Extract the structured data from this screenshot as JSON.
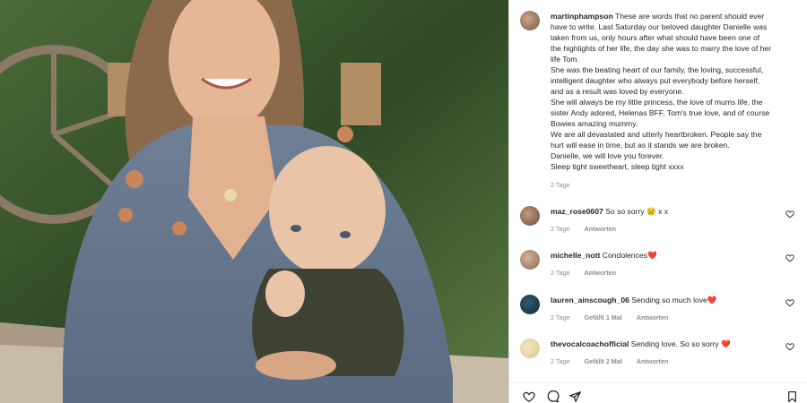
{
  "post": {
    "username": "martinphampson",
    "caption_lines": [
      "These are words that no parent should ever",
      "have to write. Last Saturday our beloved daughter Danielle was",
      "taken from us, only hours after what should have been one of",
      "the highlights of her life, the day she was to marry the love of her",
      "life Tom.",
      "She was the beating heart of our family, the loving, successful,",
      "intelligent daughter who always put everybody before herself,",
      "and as a result was loved by everyone.",
      "She will always be my little princess, the love of mums life, the",
      "sister Andy adored, Helenas BFF, Tom's true love, and of course",
      "Bowies amazing mummy.",
      "We are all devastated and utterly heartbroken. People say the",
      "hurt will ease in time, but as it stands we are broken.",
      "Danielle, we will love you forever.",
      "Sleep tight sweetheart, sleep tight xxxx"
    ],
    "time": "2 Tage"
  },
  "comments": [
    {
      "username": "maz_rose0607",
      "text": "So so sorry 😢 x x",
      "time": "2 Tage",
      "reply": "Antworten",
      "likes": ""
    },
    {
      "username": "michelle_nott",
      "text": "Condolences❤️",
      "time": "2 Tage",
      "reply": "Antworten",
      "likes": ""
    },
    {
      "username": "lauren_ainscough_06",
      "text": "Sending so much love❤️",
      "time": "2 Tage",
      "reply": "Antworten",
      "likes": "Gefällt 1 Mal"
    },
    {
      "username": "thevocalcoachofficial",
      "text": "Sending love. So so sorry ❤️",
      "time": "2 Tage",
      "reply": "Antworten",
      "likes": "Gefällt 2 Mal"
    }
  ],
  "colors": {
    "heart": "#ed4956",
    "text": "#262626",
    "meta": "#8e8e8e"
  },
  "icons": [
    "like-heart-icon",
    "comment-icon",
    "share-icon",
    "bookmark-icon"
  ]
}
